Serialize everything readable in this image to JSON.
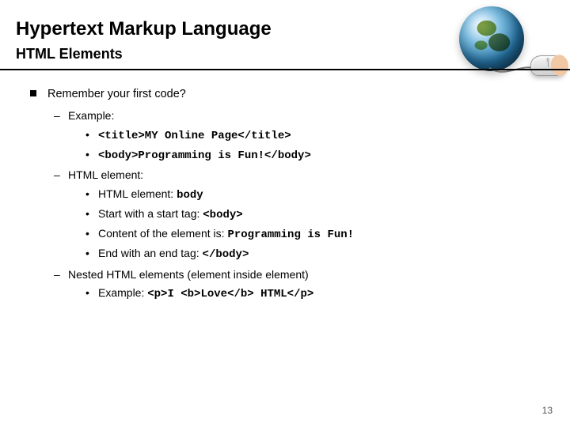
{
  "title": "Hypertext Markup Language",
  "subtitle": "HTML Elements",
  "top_line": "Remember your first code?",
  "sec1": {
    "heading": "Example:",
    "items": [
      "<title>MY Online Page</title>",
      "<body>Programming is Fun!</body>"
    ]
  },
  "sec2": {
    "heading": "HTML element:",
    "li1_prefix": "HTML element: ",
    "li1_code": "body",
    "li2_prefix": "Start with a start tag: ",
    "li2_code": "<body>",
    "li3_prefix": "Content of the element is: ",
    "li3_code": "Programming is Fun!",
    "li4_prefix": "End with an end tag: ",
    "li4_code": "</body>"
  },
  "sec3": {
    "heading": "Nested HTML elements (element inside element)",
    "li1_prefix": "Example: ",
    "li1_code": "<p>I <b>Love</b> HTML</p>"
  },
  "page_number": "13"
}
